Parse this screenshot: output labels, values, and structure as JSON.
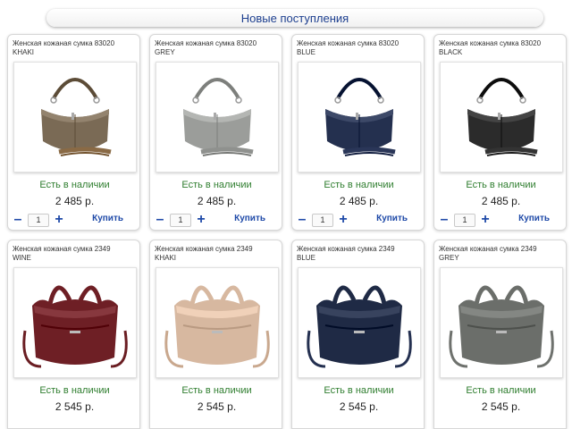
{
  "header": {
    "title": "Новые поступления"
  },
  "colors": {
    "accent": "#1d3f8f",
    "stock": "#2e7d2e"
  },
  "products": [
    {
      "title_line1": "Женская кожаная сумка 83020",
      "title_line2": "KHAKI",
      "stock": "Есть в наличии",
      "price": "2 485 р.",
      "qty": "1",
      "minus": "–",
      "plus": "+",
      "buy": "Купить",
      "bag": "hobo",
      "color": "#7a6a55",
      "strap": "#8a6a45"
    },
    {
      "title_line1": "Женская кожаная сумка 83020",
      "title_line2": "GREY",
      "stock": "Есть в наличии",
      "price": "2 485 р.",
      "qty": "1",
      "minus": "–",
      "plus": "+",
      "buy": "Купить",
      "bag": "hobo",
      "color": "#9b9d9a",
      "strap": "#8f918e"
    },
    {
      "title_line1": "Женская кожаная сумка 83020",
      "title_line2": "BLUE",
      "stock": "Есть в наличии",
      "price": "2 485 р.",
      "qty": "1",
      "minus": "–",
      "plus": "+",
      "buy": "Купить",
      "bag": "hobo",
      "color": "#24304f",
      "strap": "#2a3658"
    },
    {
      "title_line1": "Женская кожаная сумка 83020",
      "title_line2": "BLACK",
      "stock": "Есть в наличии",
      "price": "2 485 р.",
      "qty": "1",
      "minus": "–",
      "plus": "+",
      "buy": "Купить",
      "bag": "hobo",
      "color": "#2b2b2b",
      "strap": "#333333"
    },
    {
      "title_line1": "Женская кожаная сумка 2349",
      "title_line2": "WINE",
      "stock": "Есть в наличии",
      "price": "2 545 р.",
      "bag": "tote",
      "color": "#6e1f25",
      "strap": "#6a1d22"
    },
    {
      "title_line1": "Женская кожаная сумка 2349",
      "title_line2": "KHAKI",
      "stock": "Есть в наличии",
      "price": "2 545 р.",
      "bag": "tote",
      "color": "#d7b8a0",
      "strap": "#c9a88e"
    },
    {
      "title_line1": "Женская кожаная сумка 2349",
      "title_line2": "BLUE",
      "stock": "Есть в наличии",
      "price": "2 545 р.",
      "bag": "tote",
      "color": "#1f2a45",
      "strap": "#243050"
    },
    {
      "title_line1": "Женская кожаная сумка 2349",
      "title_line2": "GREY",
      "stock": "Есть в наличии",
      "price": "2 545 р.",
      "bag": "tote",
      "color": "#6b6e6a",
      "strap": "#6e716d"
    }
  ]
}
